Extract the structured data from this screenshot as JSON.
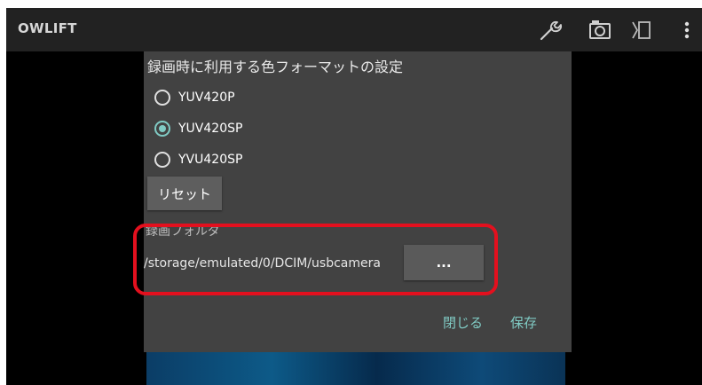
{
  "app": {
    "title": "OWLIFT",
    "actions": [
      {
        "icon": "wrench-icon"
      },
      {
        "icon": "camera-icon"
      },
      {
        "icon": "record-mode-icon"
      },
      {
        "icon": "more-vert-icon"
      }
    ]
  },
  "dialog": {
    "title": "録画時に利用する色フォーマットの設定",
    "options": [
      {
        "label": "YUV420P",
        "checked": false
      },
      {
        "label": "YUV420SP",
        "checked": true
      },
      {
        "label": "YVU420SP",
        "checked": false
      }
    ],
    "reset_label": "リセット",
    "folder_label": "録画フォルダ",
    "folder_path": "/storage/emulated/0/DCIM/usbcamera",
    "browse_label": "...",
    "close_label": "閉じる",
    "save_label": "保存"
  },
  "colors": {
    "accent": "#80cbc4",
    "appbar": "#222222",
    "dialog_bg": "#424242",
    "highlight": "#e3101e"
  }
}
